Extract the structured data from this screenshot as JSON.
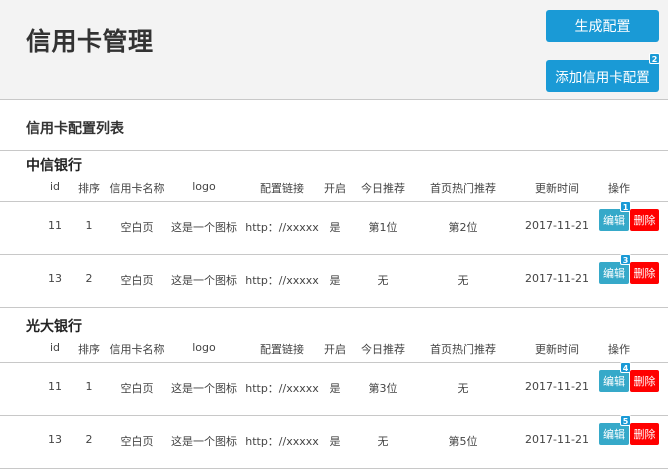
{
  "header": {
    "title": "信用卡管理",
    "generate_label": "生成配置",
    "add_label": "添加信用卡配置",
    "add_badge": "2"
  },
  "list": {
    "title": "信用卡配置列表"
  },
  "columns": [
    "id",
    "排序",
    "信用卡名称",
    "logo",
    "配置链接",
    "开启",
    "今日推荐",
    "首页热门推荐",
    "更新时间",
    "操作"
  ],
  "actions": {
    "edit": "编辑",
    "delete": "删除"
  },
  "groups": [
    {
      "bank": "中信银行",
      "rows": [
        {
          "id": "11",
          "sort": "1",
          "name": "空白页",
          "logo": "这是一个图标",
          "link": "http：//xxxxx",
          "enabled": "是",
          "today": "第1位",
          "home": "第2位",
          "updated": "2017-11-21",
          "badge": "1"
        },
        {
          "id": "13",
          "sort": "2",
          "name": "空白页",
          "logo": "这是一个图标",
          "link": "http：//xxxxx",
          "enabled": "是",
          "today": "无",
          "home": "无",
          "updated": "2017-11-21",
          "badge": "3"
        }
      ]
    },
    {
      "bank": "光大银行",
      "rows": [
        {
          "id": "11",
          "sort": "1",
          "name": "空白页",
          "logo": "这是一个图标",
          "link": "http：//xxxxx",
          "enabled": "是",
          "today": "第3位",
          "home": "无",
          "updated": "2017-11-21",
          "badge": "4"
        },
        {
          "id": "13",
          "sort": "2",
          "name": "空白页",
          "logo": "这是一个图标",
          "link": "http：//xxxxx",
          "enabled": "是",
          "today": "无",
          "home": "第5位",
          "updated": "2017-11-21",
          "badge": "5"
        }
      ]
    }
  ]
}
